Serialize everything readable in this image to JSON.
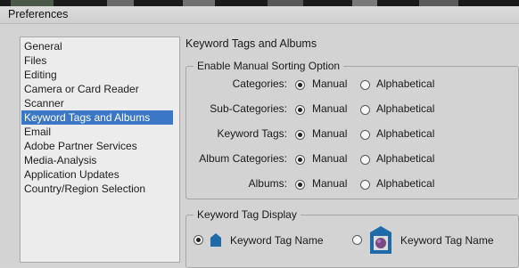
{
  "window": {
    "title": "Preferences"
  },
  "sidebar": {
    "items": [
      {
        "label": "General"
      },
      {
        "label": "Files"
      },
      {
        "label": "Editing"
      },
      {
        "label": "Camera or Card Reader"
      },
      {
        "label": "Scanner"
      },
      {
        "label": "Keyword Tags and Albums",
        "selected": true
      },
      {
        "label": "Email"
      },
      {
        "label": "Adobe Partner Services"
      },
      {
        "label": "Media-Analysis"
      },
      {
        "label": "Application Updates"
      },
      {
        "label": "Country/Region Selection"
      }
    ]
  },
  "panel": {
    "title": "Keyword Tags and Albums"
  },
  "sorting": {
    "legend": "Enable Manual Sorting Option",
    "option_manual": "Manual",
    "option_alpha": "Alphabetical",
    "rows": [
      {
        "label": "Categories:",
        "selected": "Manual"
      },
      {
        "label": "Sub-Categories:",
        "selected": "Manual"
      },
      {
        "label": "Keyword Tags:",
        "selected": "Manual"
      },
      {
        "label": "Album Categories:",
        "selected": "Manual"
      },
      {
        "label": "Albums:",
        "selected": "Manual"
      }
    ]
  },
  "tag_display": {
    "legend": "Keyword Tag Display",
    "option_small": "Keyword Tag Name",
    "option_large": "Keyword Tag Name",
    "selected": "small"
  },
  "colors": {
    "selection": "#3a77c4",
    "tag_icon": "#1f6aa8",
    "tag_photo": "#7a4a86"
  }
}
